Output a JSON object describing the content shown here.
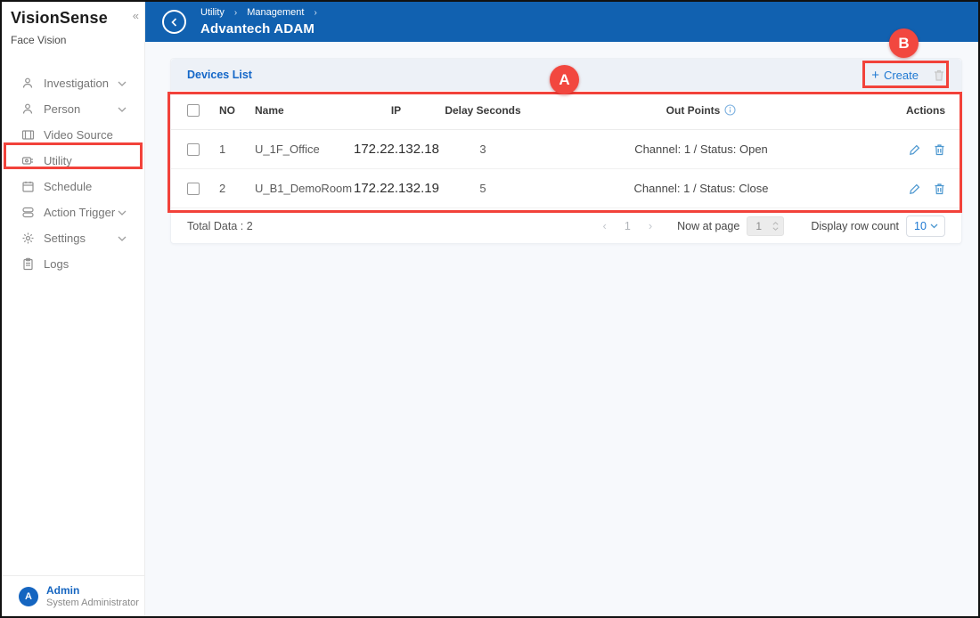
{
  "app": {
    "brand": "VisionSense",
    "subtitle": "Face Vision"
  },
  "icons": {
    "collapse": "«",
    "breadcrumb_sep": "›",
    "plus": "+",
    "pager_prev": "‹",
    "pager_next": "›"
  },
  "sidebar": {
    "items": [
      {
        "label": "Investigation",
        "icon": "person-search-icon",
        "expandable": true
      },
      {
        "label": "Person",
        "icon": "person-search-icon",
        "expandable": true
      },
      {
        "label": "Video Source",
        "icon": "video-icon",
        "expandable": false
      },
      {
        "label": "Utility",
        "icon": "utility-icon",
        "expandable": false
      },
      {
        "label": "Schedule",
        "icon": "calendar-icon",
        "expandable": false
      },
      {
        "label": "Action Trigger",
        "icon": "layers-icon",
        "expandable": true
      },
      {
        "label": "Settings",
        "icon": "gear-icon",
        "expandable": true
      },
      {
        "label": "Logs",
        "icon": "clipboard-icon",
        "expandable": false
      }
    ],
    "user": {
      "initial": "A",
      "name": "Admin",
      "role": "System Administrator"
    }
  },
  "header": {
    "breadcrumb_1": "Utility",
    "breadcrumb_2": "Management",
    "title": "Advantech ADAM"
  },
  "panel": {
    "title": "Devices List",
    "create_label": "Create"
  },
  "table": {
    "columns": {
      "no": "NO",
      "name": "Name",
      "ip": "IP",
      "delay": "Delay Seconds",
      "out": "Out Points",
      "actions": "Actions"
    },
    "rows": [
      {
        "no": "1",
        "name": "U_1F_Office",
        "ip": "172.22.132.18",
        "delay": "3",
        "out": "Channel: 1 / Status: Open"
      },
      {
        "no": "2",
        "name": "U_B1_DemoRoom",
        "ip": "172.22.132.19",
        "delay": "5",
        "out": "Channel: 1 / Status: Close"
      }
    ]
  },
  "footer": {
    "total": "Total Data : 2",
    "page_number": "1",
    "now_at_page_label": "Now at page",
    "page_input_value": "1",
    "display_row_count_label": "Display row count",
    "row_count_value": "10"
  },
  "annotations": {
    "a": "A",
    "b": "B",
    "color": "#f2423a"
  },
  "colors": {
    "header_blue": "#1161b0",
    "accent_blue": "#2079d2",
    "panel_header": "#edf1f7",
    "annotation_red": "#f2423a"
  }
}
